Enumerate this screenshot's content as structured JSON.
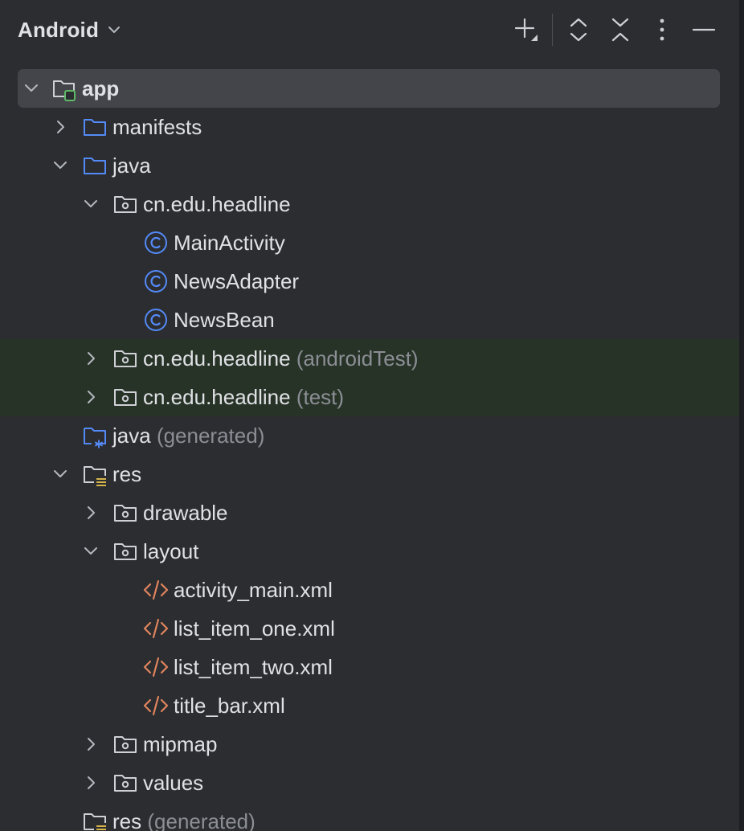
{
  "header": {
    "view_label": "Android",
    "toolbar": {
      "add_icon": "plus-icon",
      "expand_icon": "expand-all-icon",
      "collapse_icon": "collapse-all-icon",
      "options_icon": "vertical-ellipsis-icon",
      "hide_icon": "minimize-icon"
    }
  },
  "colors": {
    "background": "#2b2d30",
    "selection": "#43454a",
    "highlight_rows": "#283328",
    "folder_blue": "#548af7",
    "module_green": "#5fb865",
    "class_blue": "#548af7",
    "xml_orange": "#e0845e",
    "res_yellow": "#d6b34a",
    "dim_text": "#8b8e94"
  },
  "tree": {
    "app": {
      "label": "app",
      "icon": "module-folder-icon"
    },
    "manifests": {
      "label": "manifests",
      "icon": "folder-icon"
    },
    "java": {
      "label": "java",
      "icon": "folder-icon"
    },
    "pkg_main": {
      "label": "cn.edu.headline",
      "icon": "package-icon"
    },
    "main_activity": {
      "label": "MainActivity",
      "icon": "class-icon"
    },
    "news_adapter": {
      "label": "NewsAdapter",
      "icon": "class-icon"
    },
    "news_bean": {
      "label": "NewsBean",
      "icon": "class-icon"
    },
    "pkg_android_test": {
      "label": "cn.edu.headline",
      "suffix": "(androidTest)",
      "icon": "package-icon"
    },
    "pkg_test": {
      "label": "cn.edu.headline",
      "suffix": "(test)",
      "icon": "package-icon"
    },
    "java_generated": {
      "label": "java",
      "suffix": "(generated)",
      "icon": "generated-folder-icon"
    },
    "res": {
      "label": "res",
      "icon": "resource-folder-icon"
    },
    "drawable": {
      "label": "drawable",
      "icon": "package-icon"
    },
    "layout": {
      "label": "layout",
      "icon": "package-icon"
    },
    "activity_main": {
      "label": "activity_main.xml",
      "icon": "xml-file-icon"
    },
    "list_item_one": {
      "label": "list_item_one.xml",
      "icon": "xml-file-icon"
    },
    "list_item_two": {
      "label": "list_item_two.xml",
      "icon": "xml-file-icon"
    },
    "title_bar": {
      "label": "title_bar.xml",
      "icon": "xml-file-icon"
    },
    "mipmap": {
      "label": "mipmap",
      "icon": "package-icon"
    },
    "values": {
      "label": "values",
      "icon": "package-icon"
    },
    "res_generated": {
      "label": "res",
      "suffix": "(generated)",
      "icon": "resource-folder-icon"
    }
  }
}
